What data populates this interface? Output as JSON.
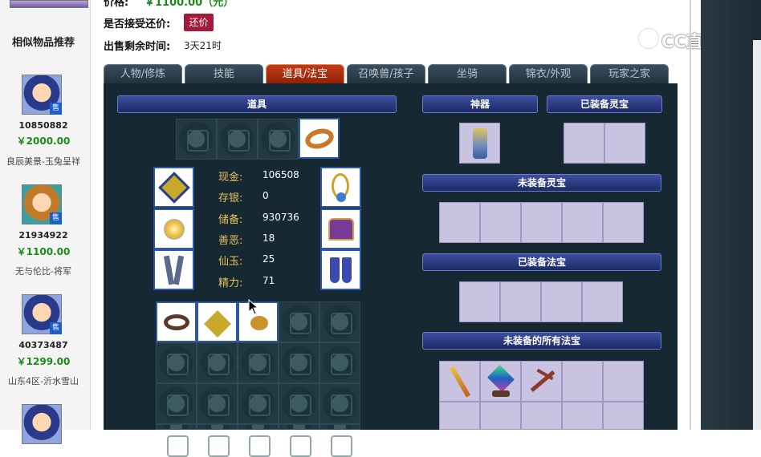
{
  "header": {
    "price_label_partial": "价格:",
    "price_value_partial": "￥1100.00（元）",
    "counter_offer_label": "是否接受还价:",
    "counter_offer_button": "还价",
    "remaining_label": "出售剩余时间:",
    "remaining_value": "3天21时"
  },
  "similar": {
    "title": "相似物品推荐",
    "sell_badge": "售",
    "items": [
      {
        "id": "10850882",
        "price": "￥2000.00",
        "name": "良辰美景-玉兔呈祥"
      },
      {
        "id": "21934922",
        "price": "￥1100.00",
        "name": "无与伦比-将军"
      },
      {
        "id": "40373487",
        "price": "￥1299.00",
        "name": "山东4区-沂水雪山"
      }
    ]
  },
  "tabs": [
    "人物/修炼",
    "技能",
    "道具/法宝",
    "召唤兽/孩子",
    "坐骑",
    "锦衣/外观",
    "玩家之家"
  ],
  "active_tab": "道具/法宝",
  "sections": {
    "items": "道具",
    "artifact": "神器",
    "equipped_spirit": "已装备灵宝",
    "unequipped_spirit": "未装备灵宝",
    "equipped_treasure": "已装备法宝",
    "all_unequipped_treasure": "未装备的所有法宝"
  },
  "stats": [
    {
      "label": "现金:",
      "value": "106508"
    },
    {
      "label": "存银:",
      "value": "0"
    },
    {
      "label": "储备:",
      "value": "930736"
    },
    {
      "label": "善恶:",
      "value": "18"
    },
    {
      "label": "仙玉:",
      "value": "25"
    },
    {
      "label": "精力:",
      "value": "71"
    }
  ],
  "watermark": "CC直播",
  "colors": {
    "active_tab": "#b8300f",
    "panel": "#162832",
    "price_green": "#1a8a1a",
    "counter_btn": "#a31a3a"
  }
}
